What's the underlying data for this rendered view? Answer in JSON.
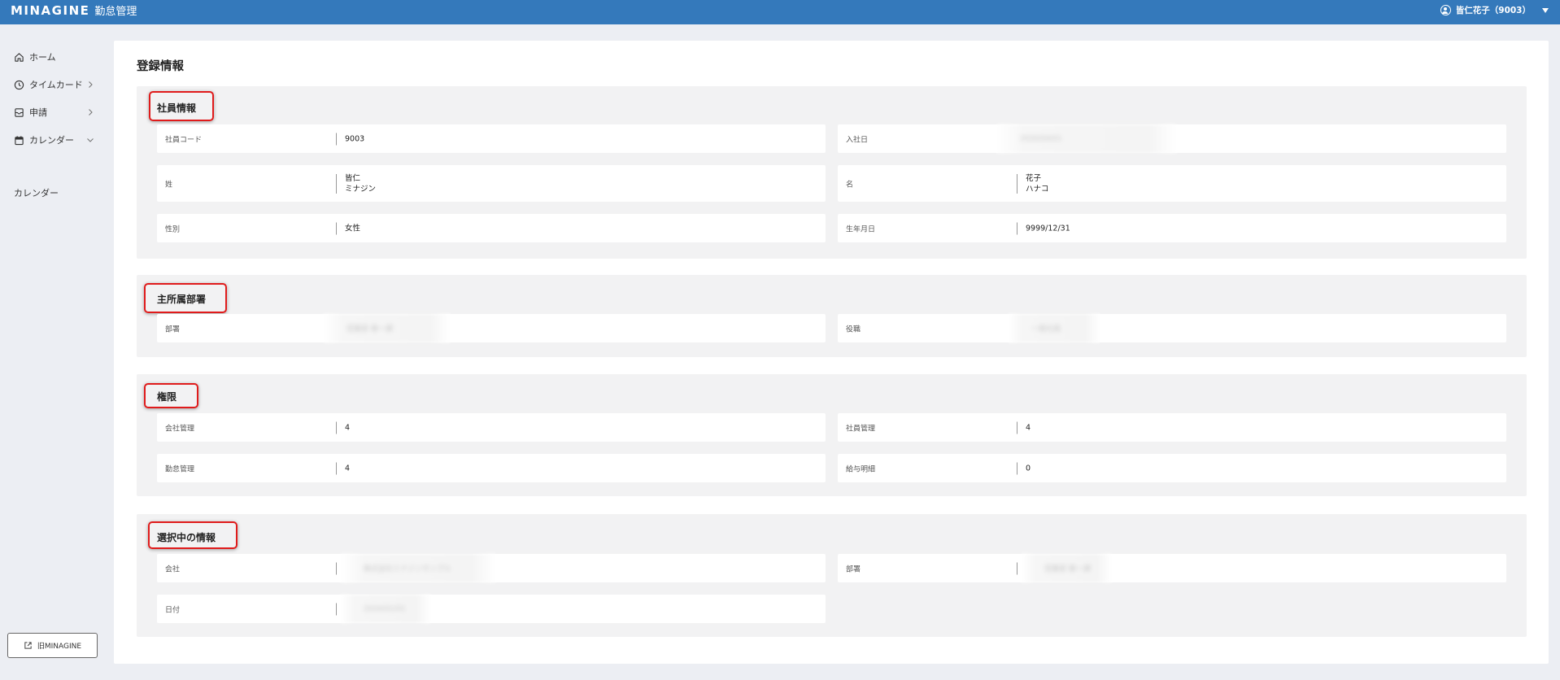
{
  "header": {
    "brand": "MINAGINE",
    "app_name": "勤怠管理",
    "user": "皆仁花子（9003）"
  },
  "sidebar": {
    "items": [
      {
        "label": "ホーム",
        "icon": "home-icon"
      },
      {
        "label": "タイムカード",
        "icon": "clock-icon"
      },
      {
        "label": "申請",
        "icon": "mail-icon"
      },
      {
        "label": "カレンダー",
        "icon": "calendar-icon"
      }
    ],
    "sub_item": "カレンダー",
    "old_button": "旧MINAGINE"
  },
  "page": {
    "title": "登録情報"
  },
  "employee": {
    "title": "社員情報",
    "code_label": "社員コード",
    "code_value": "9003",
    "join_label": "入社日",
    "join_value": "2020/04/01",
    "last_label": "姓",
    "last_kanji": "皆仁",
    "last_kana": "ミナジン",
    "first_label": "名",
    "first_kanji": "花子",
    "first_kana": "ハナコ",
    "gender_label": "性別",
    "gender_value": "女性",
    "birth_label": "生年月日",
    "birth_value": "9999/12/31"
  },
  "department": {
    "title": "主所属部署",
    "dept_label": "部署",
    "dept_value": "営業部 第一課",
    "position_label": "役職",
    "position_value": "一般社員"
  },
  "permissions": {
    "title": "権限",
    "company_label": "会社管理",
    "company_value": "4",
    "employee_label": "社員管理",
    "employee_value": "4",
    "attendance_label": "勤怠管理",
    "attendance_value": "4",
    "payslip_label": "給与明細",
    "payslip_value": "0"
  },
  "selected": {
    "title": "選択中の情報",
    "company_label": "会社",
    "company_value": "株式会社ミナジンサンプル",
    "dept_label": "部署",
    "dept_value": "営業部 第一課",
    "date_label": "日付",
    "date_value": "2024/01/01"
  },
  "colors": {
    "header": "#3479bb",
    "highlight": "#e01b1b",
    "section_bg": "#f2f2f3"
  }
}
